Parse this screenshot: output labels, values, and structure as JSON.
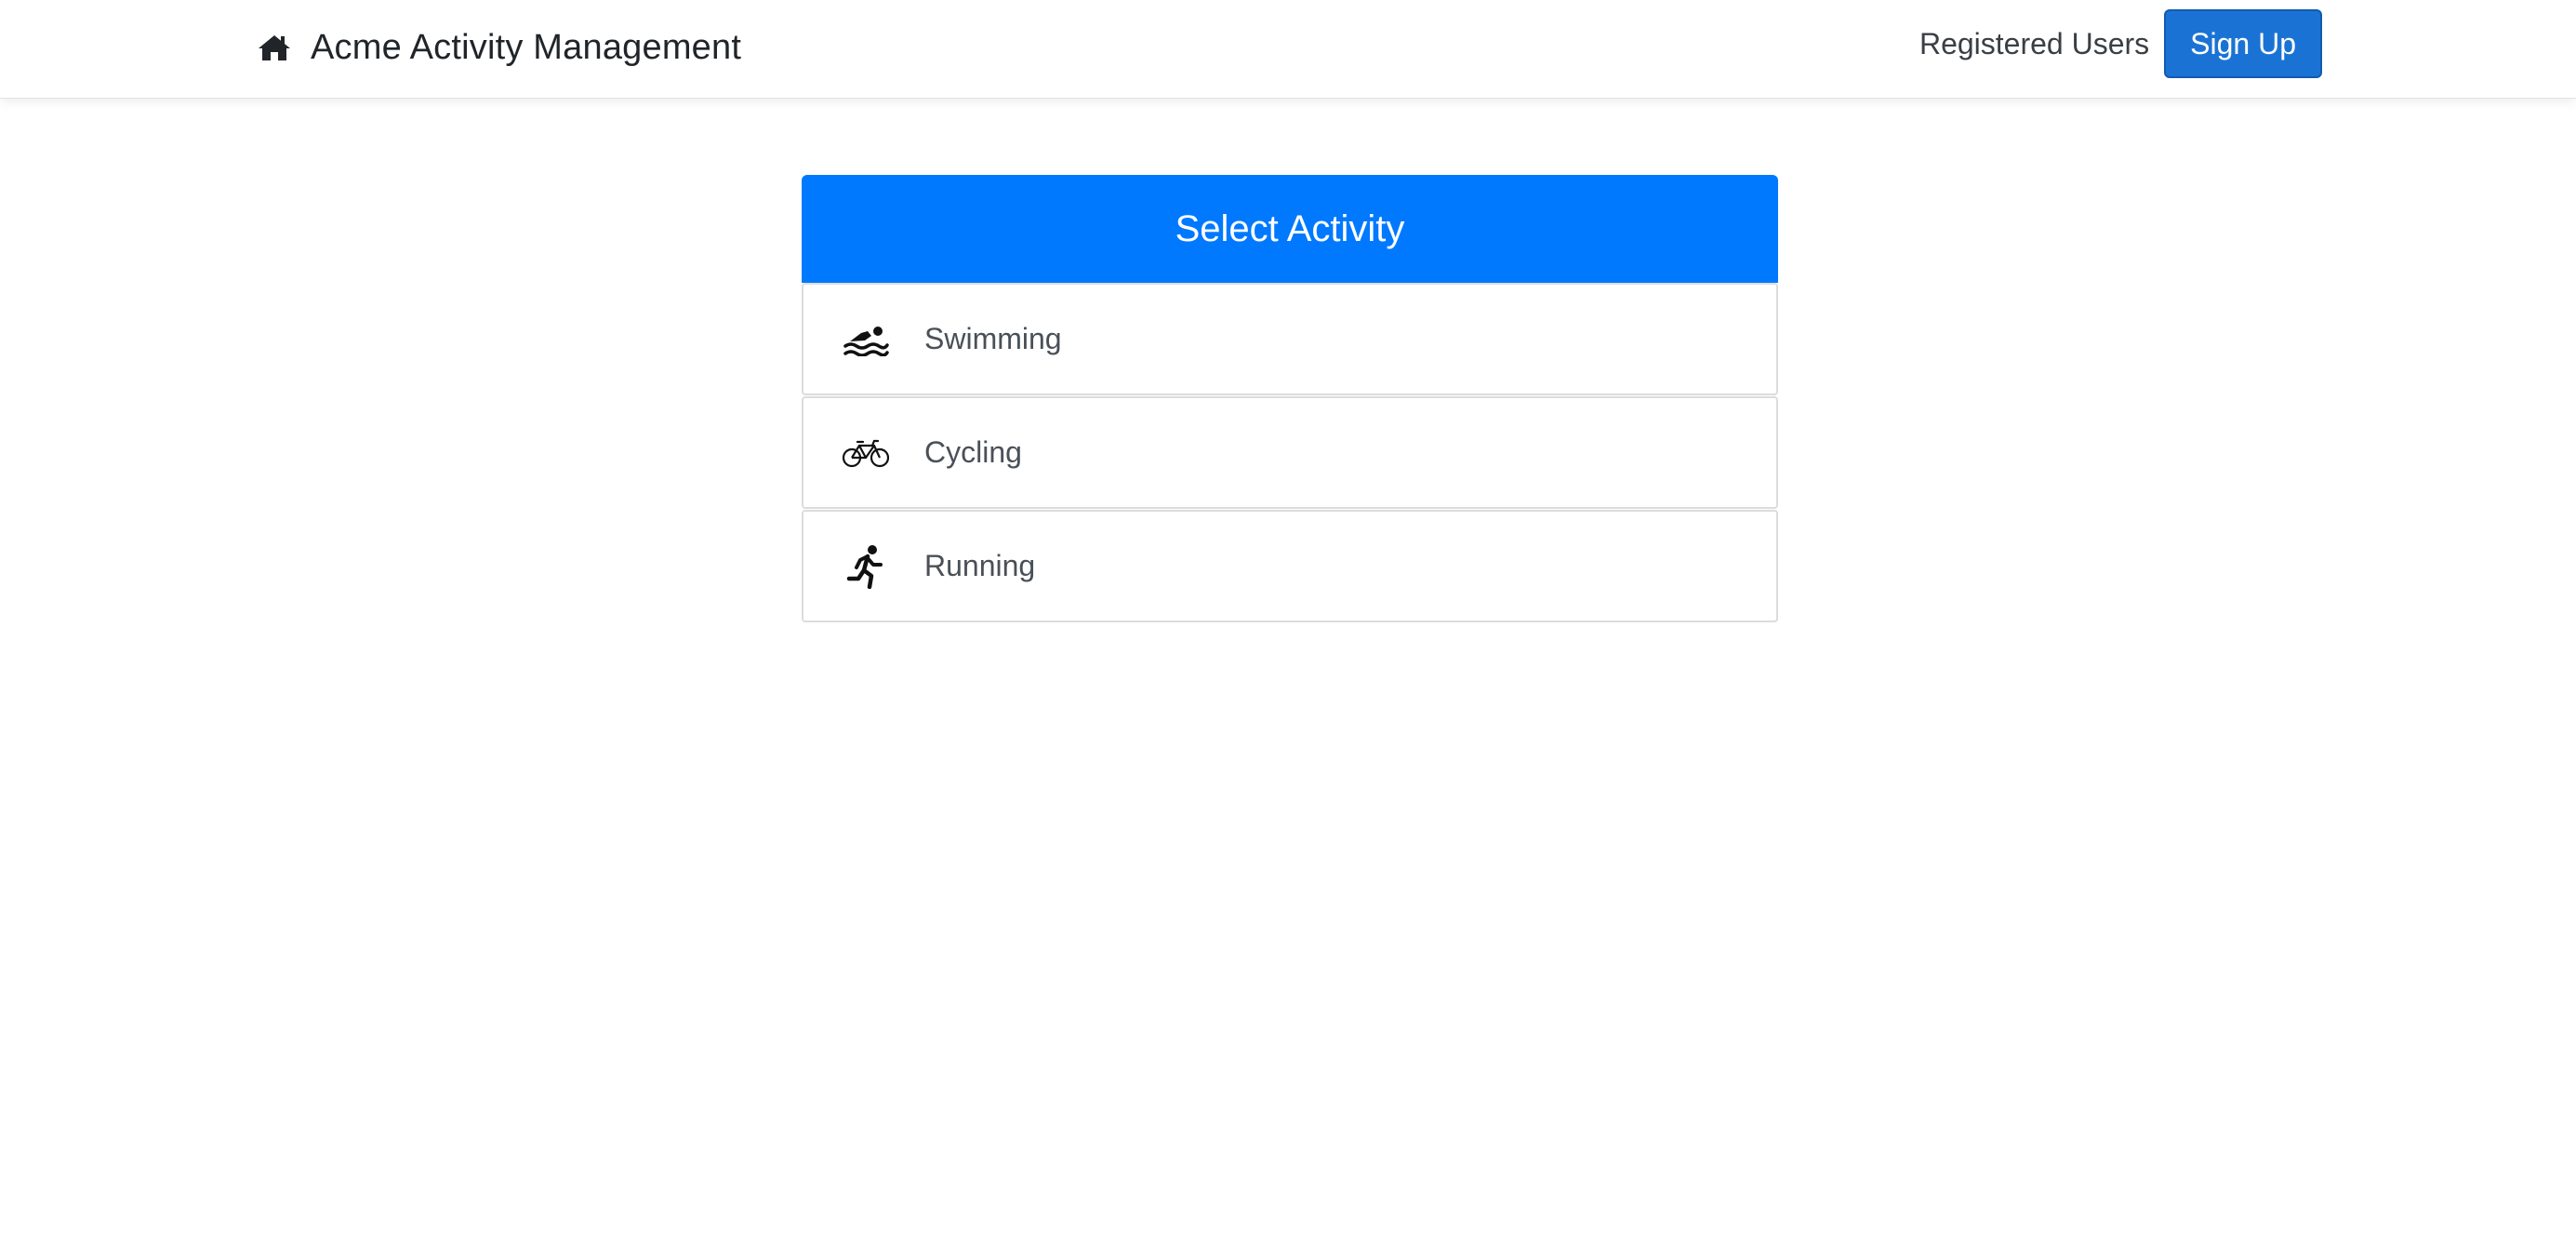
{
  "navbar": {
    "brand_icon": "home-icon",
    "brand_text": "Acme Activity Management",
    "registered_users_link": "Registered Users",
    "signup_button": "Sign Up"
  },
  "card": {
    "title": "Select Activity",
    "header_color": "#0079ff",
    "items": [
      {
        "label": "Swimming",
        "icon": "swimming-icon"
      },
      {
        "label": "Cycling",
        "icon": "bicycle-icon"
      },
      {
        "label": "Running",
        "icon": "running-icon"
      }
    ]
  },
  "colors": {
    "primary": "#0079ff",
    "button": "#1a73d4"
  }
}
